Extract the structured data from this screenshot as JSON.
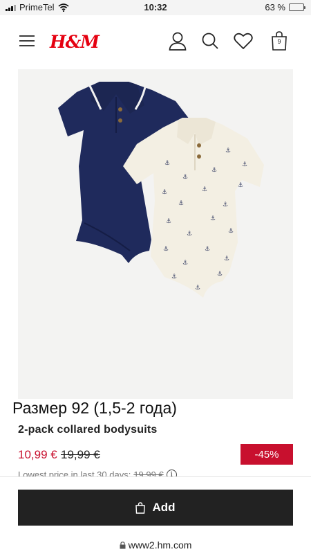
{
  "status_bar": {
    "carrier": "PrimeTel",
    "time": "10:32",
    "battery_percent": "63 %",
    "battery_level": 0.63
  },
  "header": {
    "logo": "H&M",
    "bag_count": "9",
    "icons": [
      "menu-icon",
      "user-icon",
      "search-icon",
      "heart-icon",
      "bag-icon"
    ]
  },
  "product": {
    "overlay_size_text": "Размер 92 (1,5-2 года)",
    "title": "2-pack collared bodysuits",
    "price_current": "10,99 €",
    "price_old": "19,99 €",
    "discount": "-45%",
    "lowest_price_label": "Lowest price in last 30 days:",
    "lowest_price_value": "19,99 €"
  },
  "actions": {
    "add_label": "Add"
  },
  "browser": {
    "url": "www2.hm.com"
  },
  "colors": {
    "brand_red": "#e50010",
    "sale_red": "#c8102e",
    "button_dark": "#222222",
    "navy": "#1f2a5c",
    "cream": "#f3efe3"
  }
}
